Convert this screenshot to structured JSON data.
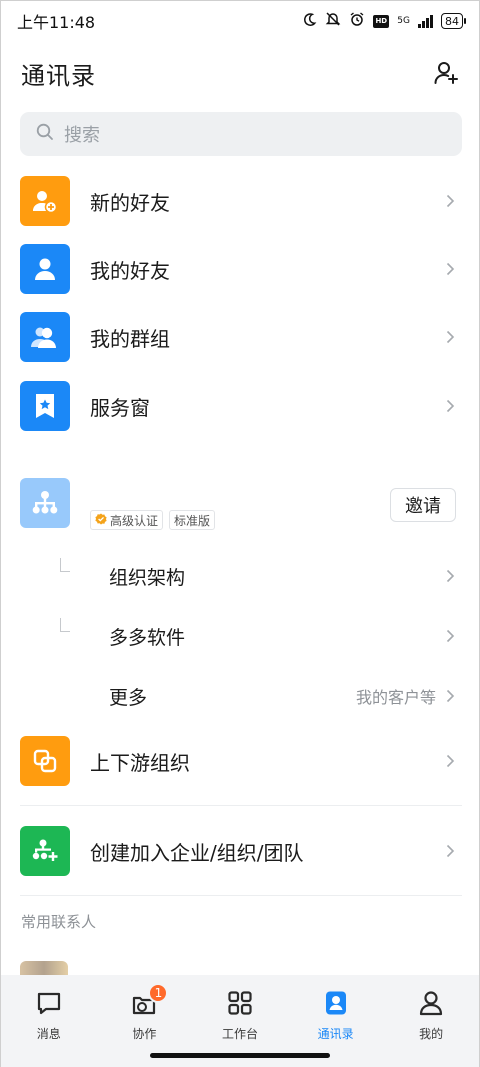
{
  "status_bar": {
    "time": "上午11:48",
    "net_label": "5G",
    "battery": "84",
    "hd_label": "HD"
  },
  "header": {
    "title": "通讯录"
  },
  "search": {
    "placeholder": "搜索"
  },
  "menu": [
    {
      "label": "新的好友"
    },
    {
      "label": "我的好友"
    },
    {
      "label": "我的群组"
    },
    {
      "label": "服务窗"
    }
  ],
  "org": {
    "badge_certified": "高级认证",
    "badge_edition": "标准版",
    "invite_label": "邀请",
    "items": [
      {
        "label": "组织架构",
        "hint": ""
      },
      {
        "label": "多多软件",
        "hint": ""
      },
      {
        "label": "更多",
        "hint": "我的客户等"
      }
    ]
  },
  "extra": [
    {
      "label": "上下游组织"
    },
    {
      "label": "创建加入企业/组织/团队"
    }
  ],
  "frequent_contacts": {
    "title": "常用联系人"
  },
  "tabbar": {
    "tabs": [
      {
        "label": "消息",
        "icon": "message-icon"
      },
      {
        "label": "协作",
        "icon": "collaboration-icon",
        "badge": "1"
      },
      {
        "label": "工作台",
        "icon": "workbench-icon"
      },
      {
        "label": "通讯录",
        "icon": "contacts-icon",
        "active": true
      },
      {
        "label": "我的",
        "icon": "profile-icon"
      }
    ]
  },
  "colors": {
    "accent": "#1b88f7",
    "orange": "#ff9c0f",
    "green": "#1db754",
    "badge_red": "#ff6a2b"
  }
}
